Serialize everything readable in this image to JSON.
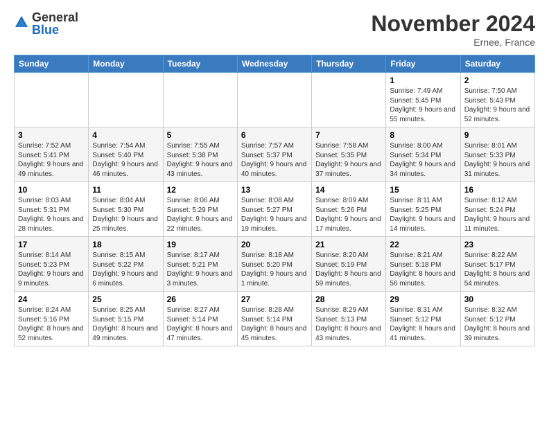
{
  "logo": {
    "general": "General",
    "blue": "Blue"
  },
  "header": {
    "month": "November 2024",
    "location": "Ernee, France"
  },
  "weekdays": [
    "Sunday",
    "Monday",
    "Tuesday",
    "Wednesday",
    "Thursday",
    "Friday",
    "Saturday"
  ],
  "weeks": [
    [
      {
        "day": "",
        "info": ""
      },
      {
        "day": "",
        "info": ""
      },
      {
        "day": "",
        "info": ""
      },
      {
        "day": "",
        "info": ""
      },
      {
        "day": "",
        "info": ""
      },
      {
        "day": "1",
        "info": "Sunrise: 7:49 AM\nSunset: 5:45 PM\nDaylight: 9 hours and 55 minutes."
      },
      {
        "day": "2",
        "info": "Sunrise: 7:50 AM\nSunset: 5:43 PM\nDaylight: 9 hours and 52 minutes."
      }
    ],
    [
      {
        "day": "3",
        "info": "Sunrise: 7:52 AM\nSunset: 5:41 PM\nDaylight: 9 hours and 49 minutes."
      },
      {
        "day": "4",
        "info": "Sunrise: 7:54 AM\nSunset: 5:40 PM\nDaylight: 9 hours and 46 minutes."
      },
      {
        "day": "5",
        "info": "Sunrise: 7:55 AM\nSunset: 5:38 PM\nDaylight: 9 hours and 43 minutes."
      },
      {
        "day": "6",
        "info": "Sunrise: 7:57 AM\nSunset: 5:37 PM\nDaylight: 9 hours and 40 minutes."
      },
      {
        "day": "7",
        "info": "Sunrise: 7:58 AM\nSunset: 5:35 PM\nDaylight: 9 hours and 37 minutes."
      },
      {
        "day": "8",
        "info": "Sunrise: 8:00 AM\nSunset: 5:34 PM\nDaylight: 9 hours and 34 minutes."
      },
      {
        "day": "9",
        "info": "Sunrise: 8:01 AM\nSunset: 5:33 PM\nDaylight: 9 hours and 31 minutes."
      }
    ],
    [
      {
        "day": "10",
        "info": "Sunrise: 8:03 AM\nSunset: 5:31 PM\nDaylight: 9 hours and 28 minutes."
      },
      {
        "day": "11",
        "info": "Sunrise: 8:04 AM\nSunset: 5:30 PM\nDaylight: 9 hours and 25 minutes."
      },
      {
        "day": "12",
        "info": "Sunrise: 8:06 AM\nSunset: 5:29 PM\nDaylight: 9 hours and 22 minutes."
      },
      {
        "day": "13",
        "info": "Sunrise: 8:08 AM\nSunset: 5:27 PM\nDaylight: 9 hours and 19 minutes."
      },
      {
        "day": "14",
        "info": "Sunrise: 8:09 AM\nSunset: 5:26 PM\nDaylight: 9 hours and 17 minutes."
      },
      {
        "day": "15",
        "info": "Sunrise: 8:11 AM\nSunset: 5:25 PM\nDaylight: 9 hours and 14 minutes."
      },
      {
        "day": "16",
        "info": "Sunrise: 8:12 AM\nSunset: 5:24 PM\nDaylight: 9 hours and 11 minutes."
      }
    ],
    [
      {
        "day": "17",
        "info": "Sunrise: 8:14 AM\nSunset: 5:23 PM\nDaylight: 9 hours and 9 minutes."
      },
      {
        "day": "18",
        "info": "Sunrise: 8:15 AM\nSunset: 5:22 PM\nDaylight: 9 hours and 6 minutes."
      },
      {
        "day": "19",
        "info": "Sunrise: 8:17 AM\nSunset: 5:21 PM\nDaylight: 9 hours and 3 minutes."
      },
      {
        "day": "20",
        "info": "Sunrise: 8:18 AM\nSunset: 5:20 PM\nDaylight: 9 hours and 1 minute."
      },
      {
        "day": "21",
        "info": "Sunrise: 8:20 AM\nSunset: 5:19 PM\nDaylight: 8 hours and 59 minutes."
      },
      {
        "day": "22",
        "info": "Sunrise: 8:21 AM\nSunset: 5:18 PM\nDaylight: 8 hours and 56 minutes."
      },
      {
        "day": "23",
        "info": "Sunrise: 8:22 AM\nSunset: 5:17 PM\nDaylight: 8 hours and 54 minutes."
      }
    ],
    [
      {
        "day": "24",
        "info": "Sunrise: 8:24 AM\nSunset: 5:16 PM\nDaylight: 8 hours and 52 minutes."
      },
      {
        "day": "25",
        "info": "Sunrise: 8:25 AM\nSunset: 5:15 PM\nDaylight: 8 hours and 49 minutes."
      },
      {
        "day": "26",
        "info": "Sunrise: 8:27 AM\nSunset: 5:14 PM\nDaylight: 8 hours and 47 minutes."
      },
      {
        "day": "27",
        "info": "Sunrise: 8:28 AM\nSunset: 5:14 PM\nDaylight: 8 hours and 45 minutes."
      },
      {
        "day": "28",
        "info": "Sunrise: 8:29 AM\nSunset: 5:13 PM\nDaylight: 8 hours and 43 minutes."
      },
      {
        "day": "29",
        "info": "Sunrise: 8:31 AM\nSunset: 5:12 PM\nDaylight: 8 hours and 41 minutes."
      },
      {
        "day": "30",
        "info": "Sunrise: 8:32 AM\nSunset: 5:12 PM\nDaylight: 8 hours and 39 minutes."
      }
    ]
  ]
}
